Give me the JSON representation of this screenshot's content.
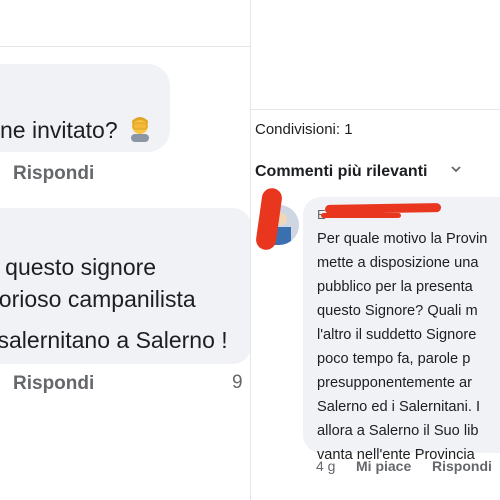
{
  "left": {
    "comment1_text": "ne invitato?",
    "emoji": "person-facepalming",
    "reply_label": "Rispondi",
    "comment2_lines": [
      "ù questo signore",
      "porioso campanilista",
      "tisalernitano a Salerno !"
    ],
    "reply_label_2": "Rispondi",
    "reaction_count": "9"
  },
  "right": {
    "shares_label": "Condivisioni: 1",
    "comments_filter": "Commenti più rilevanti",
    "commenter_name": "E",
    "comment_lines": [
      "Per quale motivo la Provin",
      "mette a disposizione una",
      "pubblico per la presenta",
      "questo Signore? Quali m",
      "l'altro il suddetto Signore",
      "poco tempo fa,  parole  p",
      "presupponentemente ar",
      "Salerno ed i Salernitani. I",
      "allora a Salerno il Suo lib",
      "vanta nell'ente Provincia"
    ],
    "time": "4 g",
    "like_label": "Mi piace",
    "reply_label": "Rispondi"
  },
  "colors": {
    "bubble_bg": "#f0f2f5",
    "secondary_text": "#65676b",
    "redaction": "#e8361f"
  }
}
